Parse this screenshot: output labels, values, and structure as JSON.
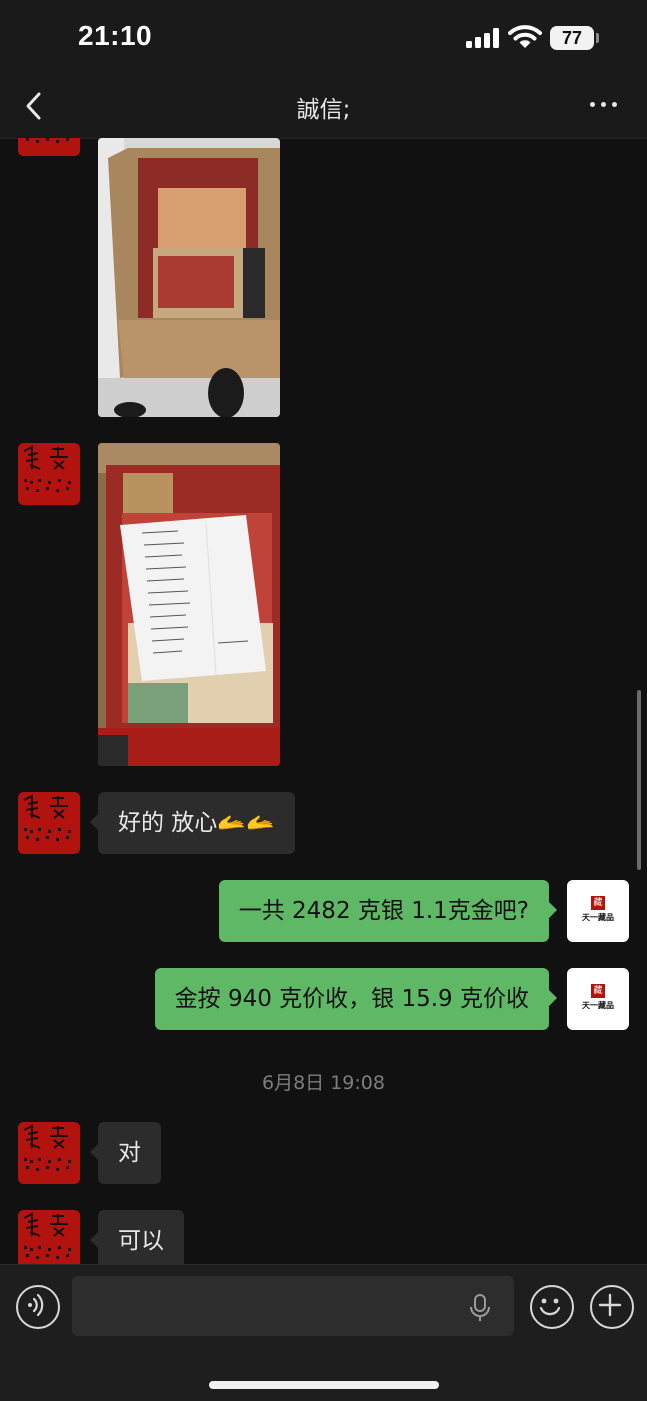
{
  "status": {
    "time": "21:10",
    "battery": "77"
  },
  "header": {
    "title": "誠信;"
  },
  "messages": [
    {
      "type": "image",
      "side": "left",
      "content": "box-of-stamp-albums-photo"
    },
    {
      "type": "image",
      "side": "left",
      "content": "handwritten-list-on-albums-photo"
    },
    {
      "type": "text",
      "side": "left",
      "text": "好的 放心🫴🫴"
    },
    {
      "type": "text",
      "side": "right",
      "text": "一共 2482 克银 1.1克金吧?"
    },
    {
      "type": "text",
      "side": "right",
      "text": "金按 940 克价收，银 15.9 克价收"
    },
    {
      "type": "time",
      "text": "6月8日 19:08"
    },
    {
      "type": "text",
      "side": "left",
      "text": "对"
    },
    {
      "type": "text",
      "side": "left",
      "text": "可以"
    }
  ],
  "contacts": {
    "shop_logo_text": "天一藏品",
    "shop_logo_seal": "藏"
  },
  "input": {
    "placeholder": ""
  },
  "colors": {
    "outgoing": "#5fb865",
    "incoming": "#2c2c2c",
    "background": "#111111",
    "seal_red": "#b3130f"
  }
}
